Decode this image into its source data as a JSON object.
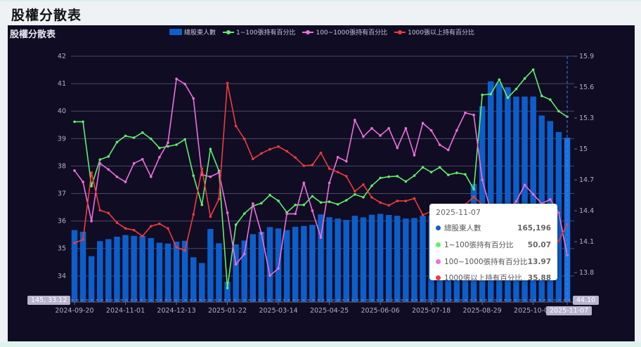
{
  "page": {
    "title": "股權分散表"
  },
  "chart_data": {
    "type": "bar+line",
    "title": "股權分散表",
    "legend": [
      "總股東人數",
      "1~100張持有百分比",
      "100~1000張持有百分比",
      "1000張以上持有百分比"
    ],
    "legend_position": "top-center",
    "x_ticks": [
      "2024-09-20",
      "2024-11-01",
      "2024-12-13",
      "2025-01-22",
      "2025-03-14",
      "2025-04-25",
      "2025-06-06",
      "2025-07-18",
      "2025-08-29",
      "2025-10-09",
      "2025-11-07"
    ],
    "x_tick_every": 6,
    "y_left": {
      "ticks": [
        "34",
        "35",
        "36",
        "37",
        "38",
        "39",
        "40",
        "41",
        "42"
      ],
      "range": [
        33.05,
        42
      ]
    },
    "y_right": {
      "ticks": [
        "13.8",
        "14.1",
        "14.4",
        "14.7",
        "15",
        "15.3",
        "15.6",
        "15.9"
      ],
      "range": [
        13.514,
        15.9
      ]
    },
    "y_hidden": {
      "range": [
        40,
        53.36
      ]
    },
    "grid": true,
    "colors": {
      "bar": "#0d5ec9",
      "green": "#5ef06a",
      "pink": "#ef6fdc",
      "red": "#ef3b3b"
    },
    "series": [
      {
        "name": "總股東人數",
        "type": "bar",
        "axis": "left",
        "values": [
          35.67,
          35.61,
          34.72,
          35.27,
          35.34,
          35.43,
          35.49,
          35.46,
          35.46,
          35.38,
          35.21,
          35.18,
          35.25,
          35.28,
          34.68,
          34.47,
          35.71,
          35.19,
          33.79,
          35.15,
          35.29,
          35.52,
          35.61,
          35.78,
          35.73,
          35.67,
          35.79,
          35.82,
          35.86,
          36.24,
          36.14,
          36.09,
          36.04,
          36.19,
          36.13,
          36.23,
          36.26,
          36.22,
          36.19,
          36.09,
          36.11,
          36.19,
          36.2,
          36.25,
          36.2,
          36.3,
          36.35,
          37.35,
          40.18,
          41.08,
          41.04,
          40.87,
          40.53,
          40.53,
          40.53,
          39.84,
          39.64,
          39.24,
          39.03
        ]
      },
      {
        "name": "1~100張持有百分比",
        "type": "line",
        "axis": "hidden",
        "values": [
          49.8,
          49.8,
          46.3,
          47.74,
          47.91,
          48.69,
          49.03,
          48.93,
          49.21,
          48.87,
          48.37,
          48.46,
          48.55,
          48.84,
          46.87,
          45.28,
          48.31,
          47.13,
          40.76,
          44.2,
          44.81,
          45.22,
          45.37,
          45.81,
          45.5,
          44.87,
          45.28,
          45.28,
          45.75,
          45.41,
          45.45,
          45.31,
          45.53,
          45.85,
          45.69,
          46.32,
          46.74,
          46.81,
          46.84,
          46.55,
          46.87,
          47.32,
          47.06,
          47.32,
          46.91,
          47.02,
          46.94,
          46.13,
          51.26,
          51.3,
          52.09,
          51.1,
          51.58,
          52.15,
          52.63,
          51.2,
          51.0,
          50.37,
          50.07
        ]
      },
      {
        "name": "100~1000張持有百分比",
        "type": "line",
        "axis": "right",
        "values": [
          14.79,
          14.68,
          14.3,
          14.86,
          14.8,
          14.73,
          14.68,
          14.86,
          14.9,
          14.73,
          14.92,
          15.06,
          15.68,
          15.63,
          15.49,
          14.75,
          14.73,
          14.77,
          14.38,
          13.88,
          13.98,
          14.47,
          14.18,
          13.77,
          13.84,
          14.37,
          14.37,
          14.67,
          14.4,
          14.14,
          14.67,
          14.92,
          14.88,
          15.28,
          15.12,
          15.2,
          15.13,
          15.2,
          15.01,
          15.2,
          14.94,
          15.25,
          15.18,
          15.04,
          14.99,
          15.18,
          15.35,
          15.33,
          14.7,
          14.4,
          14.3,
          14.4,
          14.49,
          14.65,
          14.56,
          14.47,
          14.51,
          14.38,
          13.97
        ]
      },
      {
        "name": "1000張以上持有百分比",
        "type": "line",
        "axis": "left",
        "values": [
          35.2,
          35.32,
          37.76,
          36.39,
          36.29,
          35.94,
          35.73,
          35.67,
          35.45,
          35.81,
          35.9,
          35.73,
          35.04,
          34.93,
          36.24,
          37.91,
          36.16,
          36.8,
          41.02,
          39.46,
          38.99,
          38.26,
          38.46,
          38.61,
          38.71,
          38.54,
          38.31,
          38.01,
          38.04,
          38.48,
          37.91,
          37.78,
          37.63,
          37.08,
          37.33,
          36.86,
          36.67,
          36.57,
          36.73,
          36.73,
          36.82,
          36.22,
          36.35,
          36.45,
          36.5,
          36.45,
          36.6,
          36.88,
          36.6,
          36.4,
          36.3,
          36.2,
          36.1,
          36.0,
          35.8,
          35.6,
          35.4,
          35.27,
          35.88
        ]
      }
    ],
    "tooltip": {
      "date": "2025-11-07",
      "rows": [
        {
          "label": "總股東人數",
          "value": "165,196"
        },
        {
          "label": "1~100張持有百分比",
          "value": "50.07"
        },
        {
          "label": "100~1000張持有百分比",
          "value": "13.97"
        },
        {
          "label": "1000張以上持有百分比",
          "value": "35.88"
        }
      ]
    },
    "crosshair": {
      "left_label": "145,  33.12",
      "right_label": "44.10",
      "x_label": "2025-11-07"
    }
  }
}
